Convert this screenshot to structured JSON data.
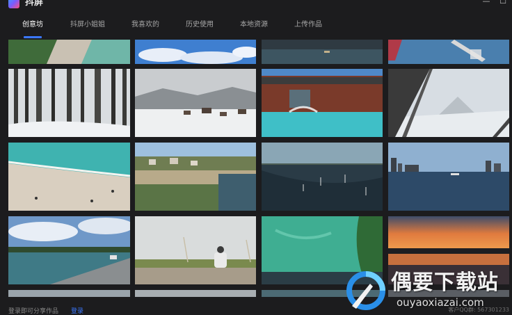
{
  "app": {
    "title": "抖屏"
  },
  "window_controls": {
    "minimize": "—",
    "maximize": "☐"
  },
  "tabs": [
    {
      "label": "创意坊",
      "active": true
    },
    {
      "label": "抖屏小姐姐",
      "active": false
    },
    {
      "label": "我喜欢的",
      "active": false
    },
    {
      "label": "历史使用",
      "active": false
    },
    {
      "label": "本地资源",
      "active": false
    },
    {
      "label": "上传作品",
      "active": false
    }
  ],
  "gallery": {
    "thumbnails": [
      {
        "scene": "coast-path-cropped"
      },
      {
        "scene": "blue-sky-clouds-cropped"
      },
      {
        "scene": "dusk-water-cropped"
      },
      {
        "scene": "pier-red-boat-cropped"
      },
      {
        "scene": "snowy-forest"
      },
      {
        "scene": "snowy-village"
      },
      {
        "scene": "pool-house"
      },
      {
        "scene": "mountain-bridge"
      },
      {
        "scene": "turquoise-beach"
      },
      {
        "scene": "clifftop-village"
      },
      {
        "scene": "lake-sailboats"
      },
      {
        "scene": "city-lake"
      },
      {
        "scene": "lakeside-road"
      },
      {
        "scene": "person-sitting-grass"
      },
      {
        "scene": "aerial-green-shore"
      },
      {
        "scene": "sunset-lake"
      }
    ]
  },
  "footer": {
    "text": "登录即可分享作品",
    "link": "登录",
    "right_text": "客户QQ群: 567301233"
  },
  "watermark": {
    "text": "偶要下载站",
    "url": "ouyaoxiazai.com"
  },
  "colors": {
    "background": "#1c1c1e",
    "accent": "#3b78ff"
  }
}
